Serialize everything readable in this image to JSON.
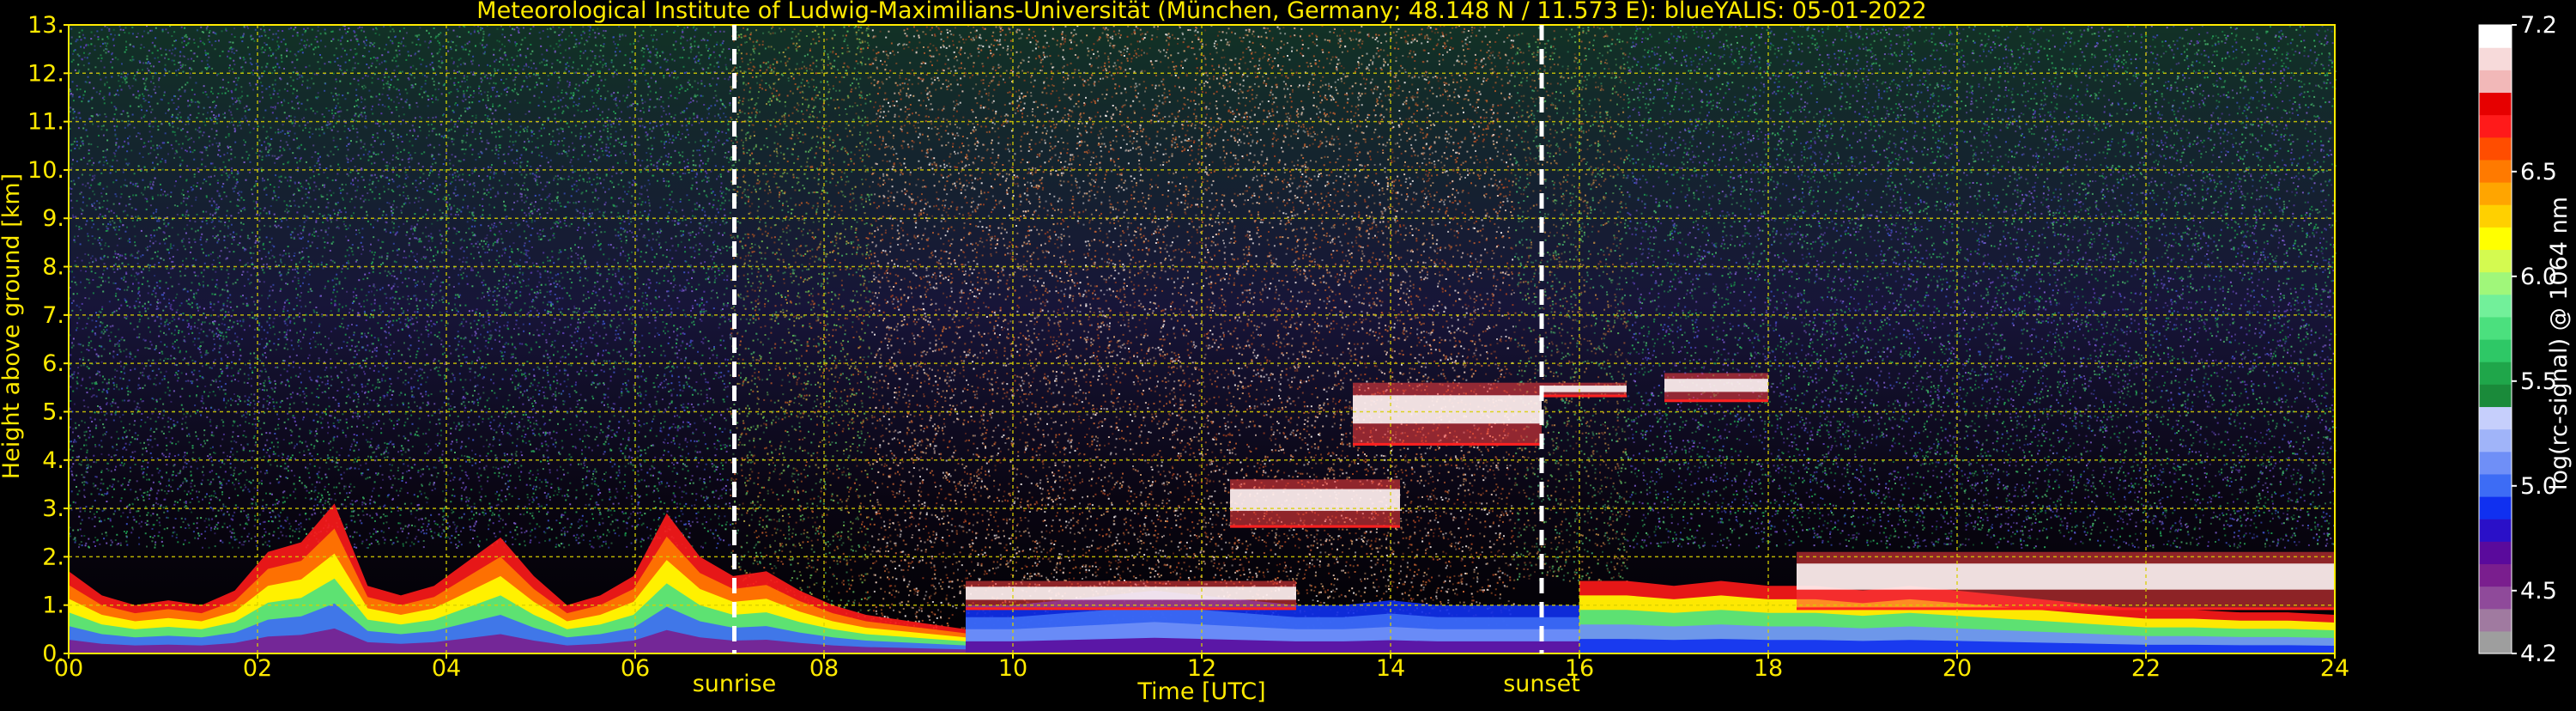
{
  "chart_data": {
    "type": "heatmap",
    "title": "Meteorological Institute of Ludwig-Maximilians-Universität (München, Germany; 48.148 N / 11.573 E):    blueYALIS: 05-01-2022",
    "xlabel": "Time [UTC]",
    "ylabel": "Height above ground [km]",
    "xlim": [
      0,
      24
    ],
    "ylim": [
      0,
      13
    ],
    "x_ticks": [
      "00",
      "02",
      "04",
      "06",
      "08",
      "10",
      "12",
      "14",
      "16",
      "18",
      "20",
      "22",
      "24"
    ],
    "y_ticks": [
      "0.",
      "1.",
      "2.",
      "3.",
      "4.",
      "5.",
      "6.",
      "7.",
      "8.",
      "9.",
      "10.",
      "11.",
      "12.",
      "13."
    ],
    "grid": true,
    "events": [
      {
        "label": "sunrise",
        "time": 7.05
      },
      {
        "label": "sunset",
        "time": 15.6
      }
    ],
    "colorbar": {
      "label": "log(rc-signal) @ 1064 nm",
      "range": [
        4.2,
        7.2
      ],
      "ticks": [
        "4.2",
        "4.5",
        "5.0",
        "5.5",
        "6.0",
        "6.5",
        "7.2"
      ],
      "tick_values": [
        4.2,
        4.5,
        5.0,
        5.5,
        6.0,
        6.5,
        7.2
      ],
      "colors": [
        "#9e9e9e",
        "#a07aa0",
        "#8f4a9a",
        "#7a1e8e",
        "#5a0a9c",
        "#2a10c8",
        "#1030f0",
        "#3d6cf5",
        "#6f8ff7",
        "#a0b4f9",
        "#c6cffc",
        "#1a8a3a",
        "#1fa64a",
        "#2ec866",
        "#4be07e",
        "#72f09a",
        "#a0f77a",
        "#d4fa50",
        "#ffff00",
        "#ffd000",
        "#ffa500",
        "#ff7a00",
        "#ff4d00",
        "#ff1a1a",
        "#e60000",
        "#f2b8b8",
        "#f7dada",
        "#ffffff"
      ]
    },
    "noise_regions": [
      {
        "t0": 0,
        "t1": 7.0,
        "h0": 2.2,
        "h1": 13,
        "c": [
          "#1a8f4a",
          "#2aa65a",
          "#5a3db0",
          "#3a4fbf",
          "#49b06a",
          "#7a5ac8"
        ]
      },
      {
        "t0": 7.0,
        "t1": 8.5,
        "h0": 0.5,
        "h1": 13,
        "c": [
          "#6ab04a",
          "#b0a040",
          "#c05a2a",
          "#5ab05a",
          "#a05020",
          "#40a060"
        ]
      },
      {
        "t0": 8.5,
        "t1": 15.3,
        "h0": 0.5,
        "h1": 13,
        "c": [
          "#d2a070",
          "#c06030",
          "#e0c0b0",
          "#b05a2a",
          "#e8e0e0",
          "#a04020"
        ]
      },
      {
        "t0": 15.3,
        "t1": 16.5,
        "h0": 1.5,
        "h1": 13,
        "c": [
          "#5ab05a",
          "#b08040",
          "#3aa06a",
          "#905030"
        ]
      },
      {
        "t0": 16.5,
        "t1": 24,
        "h0": 2.2,
        "h1": 13,
        "c": [
          "#1a8f4a",
          "#2aa65a",
          "#5a3db0",
          "#3a4fbf",
          "#49b06a",
          "#7a5ac8"
        ]
      }
    ],
    "features": [
      {
        "type": "aerosol_layer",
        "t0": 0.0,
        "t1": 9.5,
        "top": [
          1.7,
          1.2,
          1.0,
          1.1,
          1.0,
          1.3,
          2.1,
          2.3,
          3.1,
          1.4,
          1.2,
          1.4,
          1.9,
          2.4,
          1.6,
          1.0,
          1.2,
          1.6,
          2.9,
          2.0,
          1.6,
          1.7,
          1.3,
          1.0,
          0.8,
          0.7,
          0.6,
          0.5
        ],
        "colors": [
          "#ff1a1a",
          "#ff7a00",
          "#ffff00",
          "#4be07e",
          "#3d6cf5",
          "#7a1e8e"
        ]
      },
      {
        "type": "aerosol_layer",
        "t0": 9.5,
        "t1": 16.0,
        "top": [
          1.0,
          1.0,
          1.1,
          1.2,
          1.3,
          1.2,
          1.1,
          1.0,
          1.0,
          1.1,
          1.0,
          1.0,
          1.0,
          1.0
        ],
        "colors": [
          "#1030f0",
          "#3d6cf5",
          "#6f8ff7",
          "#5a0a9c"
        ]
      },
      {
        "type": "aerosol_layer",
        "t0": 16.0,
        "t1": 24.0,
        "top": [
          1.5,
          1.5,
          1.4,
          1.5,
          1.4,
          1.4,
          1.3,
          1.4,
          1.3,
          1.2,
          1.1,
          1.0,
          0.9,
          0.9,
          0.85,
          0.85,
          0.8
        ],
        "colors": [
          "#ff1a1a",
          "#ffff00",
          "#4be07e",
          "#6f8ff7",
          "#1030f0"
        ]
      },
      {
        "type": "cloud",
        "t0": 13.6,
        "t1": 15.6,
        "h0": 4.3,
        "h1": 5.6
      },
      {
        "type": "cloud",
        "t0": 15.6,
        "t1": 16.5,
        "h0": 5.3,
        "h1": 5.6
      },
      {
        "type": "cloud",
        "t0": 16.9,
        "t1": 18.0,
        "h0": 5.2,
        "h1": 5.8
      },
      {
        "type": "cloud",
        "t0": 12.3,
        "t1": 14.1,
        "h0": 2.6,
        "h1": 3.6
      },
      {
        "type": "cloud",
        "t0": 18.3,
        "t1": 24.0,
        "h0": 0.9,
        "h1": 2.1
      },
      {
        "type": "cloud",
        "t0": 9.5,
        "t1": 13.0,
        "h0": 0.9,
        "h1": 1.5
      }
    ]
  }
}
